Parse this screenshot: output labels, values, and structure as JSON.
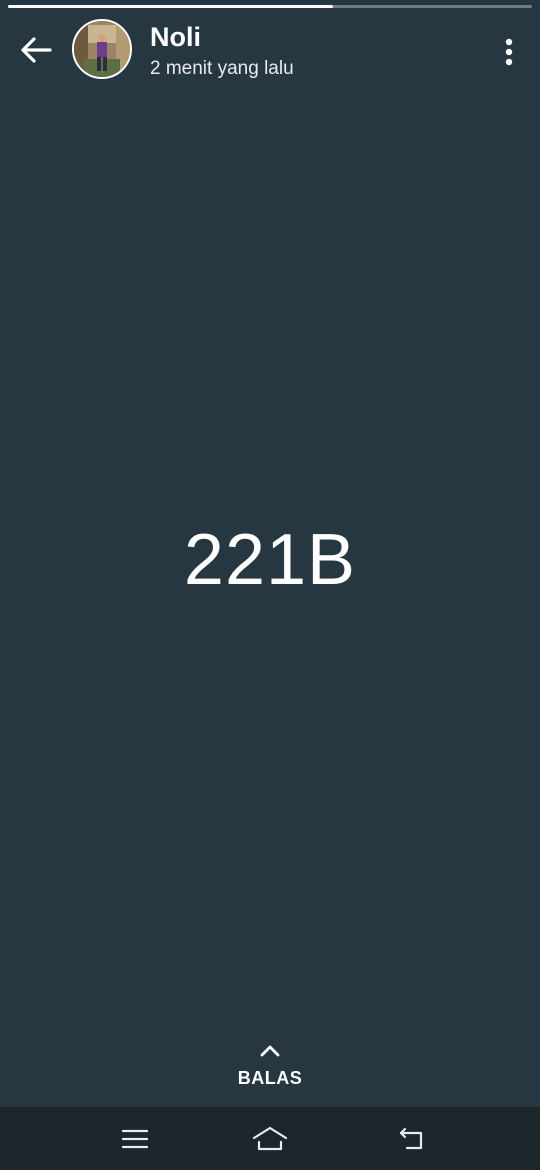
{
  "story": {
    "progress_fraction": 0.62,
    "author_name": "Noli",
    "time_ago": "2 menit yang lalu",
    "text": "221B"
  },
  "reply": {
    "label": "BALAS",
    "icon": "chevron-up-icon"
  },
  "header_icons": {
    "back": "arrow-left-icon",
    "menu": "more-vertical-icon"
  },
  "navbar": {
    "recents_icon": "recents-icon",
    "home_icon": "home-icon",
    "back_icon": "back-icon"
  },
  "colors": {
    "background": "#263742",
    "navbar": "#1d262b",
    "text": "#ffffff"
  }
}
